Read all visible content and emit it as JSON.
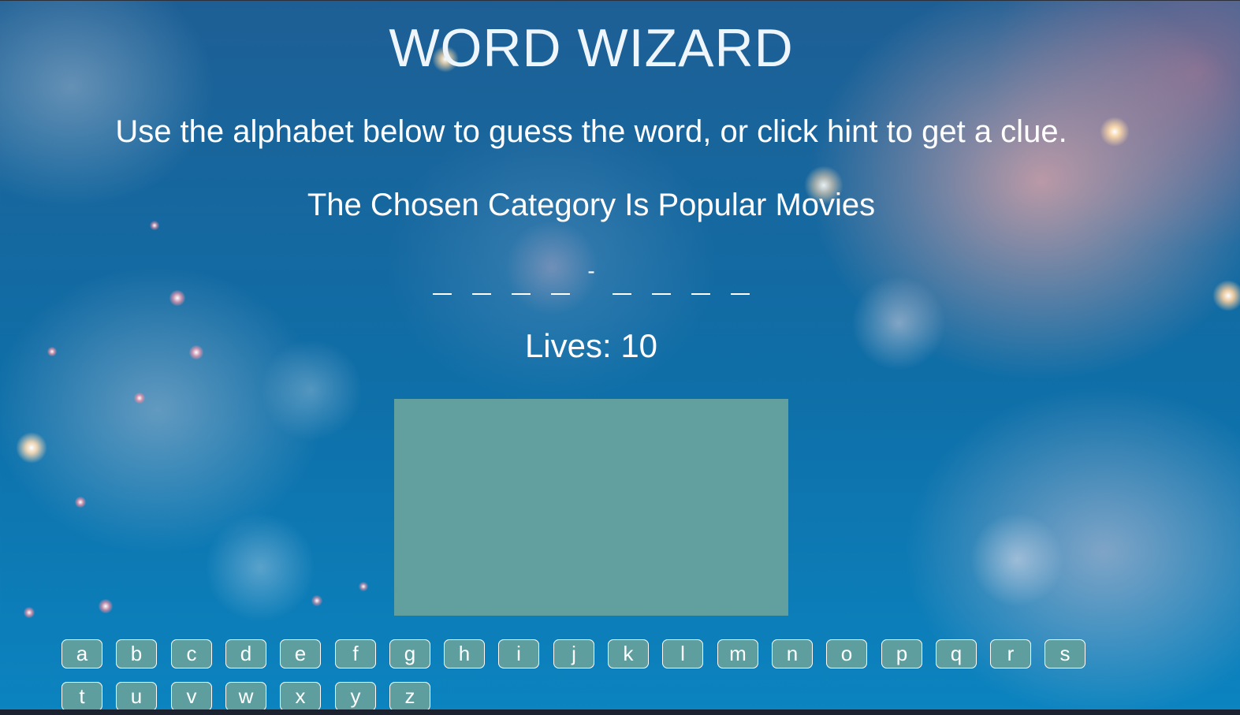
{
  "game": {
    "title": "WORD WIZARD",
    "instructions": "Use the alphabet below to guess the word, or click hint to get a clue.",
    "category_text": "The Chosen Category Is Popular Movies",
    "word_display": [
      "_",
      "_",
      "_",
      "_",
      "-",
      "_",
      "_",
      "_",
      "_"
    ],
    "lives_text": "Lives: 10"
  },
  "alphabet": [
    "a",
    "b",
    "c",
    "d",
    "e",
    "f",
    "g",
    "h",
    "i",
    "j",
    "k",
    "l",
    "m",
    "n",
    "o",
    "p",
    "q",
    "r",
    "s",
    "t",
    "u",
    "v",
    "w",
    "x",
    "y",
    "z"
  ],
  "colors": {
    "button_bg": "#5e9e9e",
    "canvas_bg": "#62a0a0",
    "text": "#ffffff"
  }
}
